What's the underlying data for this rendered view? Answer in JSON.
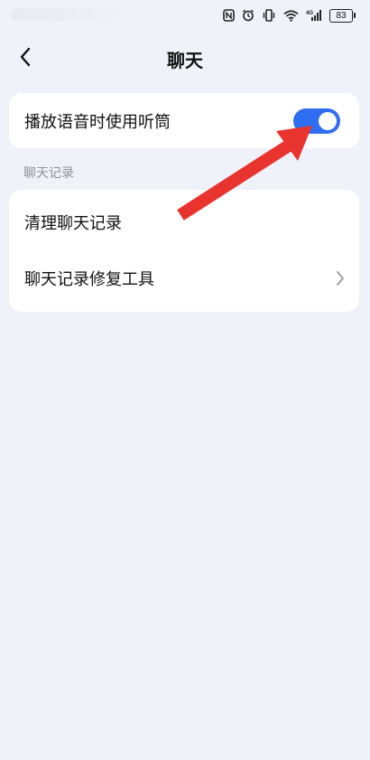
{
  "status_bar": {
    "battery_level": "83",
    "icons": [
      "nfc-icon",
      "alarm-icon",
      "vibrate-icon",
      "wifi-icon",
      "signal-4g-icon",
      "battery-icon"
    ]
  },
  "header": {
    "title": "聊天",
    "back_icon": "chevron-left-icon"
  },
  "settings": {
    "play_voice_earpiece": {
      "label": "播放语音时使用听筒",
      "enabled": true
    },
    "section_chat_history": "聊天记录",
    "clear_history": {
      "label": "清理聊天记录"
    },
    "repair_tool": {
      "label": "聊天记录修复工具",
      "icon": "chevron-right-icon"
    }
  },
  "annotation": {
    "arrow_color": "#e8332f"
  },
  "colors": {
    "background": "#eff2f9",
    "toggle_on": "#2f6ef2",
    "card": "#ffffff",
    "secondary_text": "#8d9099"
  }
}
